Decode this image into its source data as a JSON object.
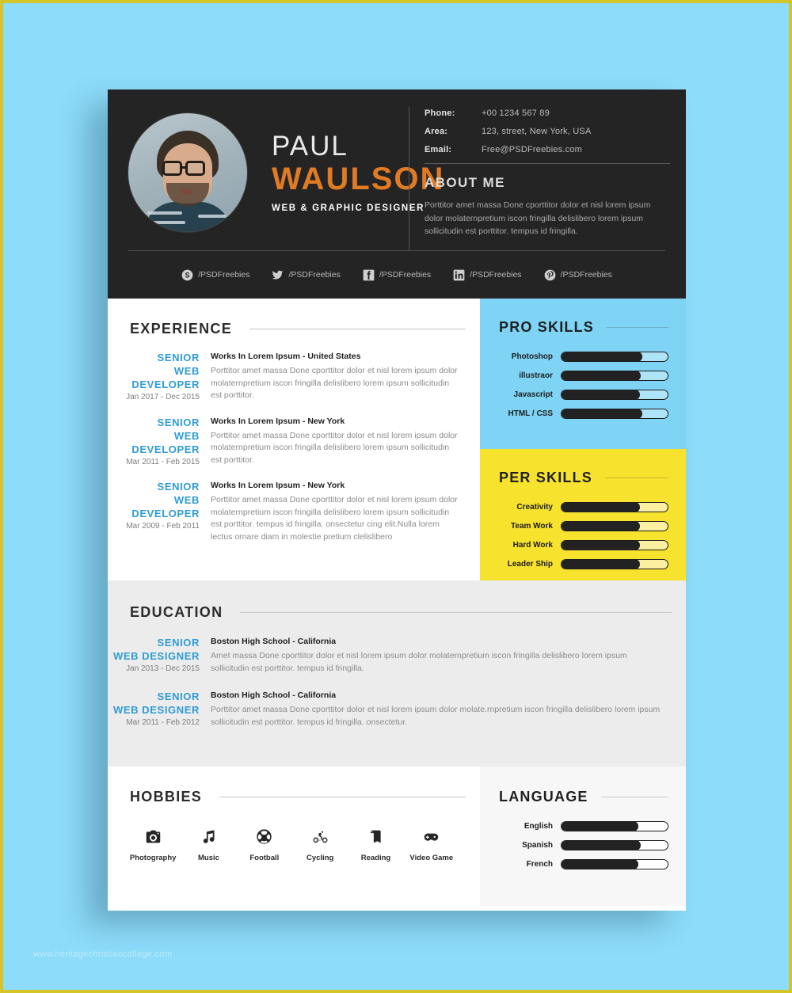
{
  "page": {
    "background_color": "#8ddcfa",
    "border_color": "#d4c629",
    "watermark": "www.heritagechristiancollege.com"
  },
  "colors": {
    "header_bg": "#242424",
    "accent_orange": "#e07b24",
    "accent_blue": "#2e9bd6",
    "panel_blue": "#7fd3f5",
    "panel_yellow": "#f7e22e",
    "education_bg": "#ececec",
    "bar_fill": "#222222"
  },
  "header": {
    "avatar_alt": "profile-photo",
    "name_first": "PAUL",
    "name_last": "WAULSON",
    "job_title": "WEB & GRAPHIC DESIGNER",
    "contacts": [
      {
        "label": "Phone:",
        "value": "+00 1234 567 89"
      },
      {
        "label": "Area:",
        "value": "123, street, New York, USA"
      },
      {
        "label": "Email:",
        "value": "Free@PSDFreebies.com"
      }
    ],
    "about_title": "ABOUT ME",
    "about_text": "Porttitor amet massa Done cporttitor dolor et nisl lorem ipsum dolor molaternpretium iscon fringilla delislibero lorem ipsum sollicitudin est porttitor. tempus id fringilla.",
    "socials": [
      {
        "icon": "skype-icon",
        "handle": "/PSDFreebies"
      },
      {
        "icon": "twitter-icon",
        "handle": "/PSDFreebies"
      },
      {
        "icon": "facebook-icon",
        "handle": "/PSDFreebies"
      },
      {
        "icon": "linkedin-icon",
        "handle": "/PSDFreebies"
      },
      {
        "icon": "pinterest-icon",
        "handle": "/PSDFreebies"
      }
    ]
  },
  "experience": {
    "title": "EXPERIENCE",
    "items": [
      {
        "role_line1": "SENIOR",
        "role_line2": "WEB DEVELOPER",
        "date": "Jan 2017 - Dec 2015",
        "company": "Works In Lorem Ipsum - United States",
        "description": "Porttitor amet massa Done cporttitor dolor et nisl lorem ipsum dolor molaternpretium iscon fringilla delislibero lorem ipsum sollicitudin est porttitor."
      },
      {
        "role_line1": "SENIOR",
        "role_line2": "WEB DEVELOPER",
        "date": "Mar 2011 - Feb 2015",
        "company": "Works In Lorem Ipsum - New York",
        "description": "Porttitor amet massa Done cporttitor dolor et nisl lorem ipsum dolor molaternpretium iscon fringilla delislibero lorem ipsum sollicitudin est porttitor."
      },
      {
        "role_line1": "SENIOR",
        "role_line2": "WEB DEVELOPER",
        "date": "Mar 2009 - Feb 2011",
        "company": "Works In Lorem Ipsum - New York",
        "description": "Porttitor amet massa Done cporttitor dolor et nisl lorem ipsum dolor molaternpretium iscon fringilla delislibero lorem ipsum sollicitudin est porttitor. tempus id fringilla. onsectetur cing elit.Nulla lorem lectus ornare diam in molestie pretium clelislibero"
      }
    ]
  },
  "pro_skills": {
    "title": "PRO SKILLS",
    "items": [
      {
        "name": "Photoshop",
        "value": 75
      },
      {
        "name": "illustraor",
        "value": 74
      },
      {
        "name": "Javascript",
        "value": 73
      },
      {
        "name": "HTML / CSS",
        "value": 75
      }
    ]
  },
  "per_skills": {
    "title": "PER SKILLS",
    "items": [
      {
        "name": "Creativity",
        "value": 73
      },
      {
        "name": "Team Work",
        "value": 73
      },
      {
        "name": "Hard Work",
        "value": 73
      },
      {
        "name": "Leader Ship",
        "value": 73
      }
    ]
  },
  "education": {
    "title": "EDUCATION",
    "items": [
      {
        "role_line1": "SENIOR",
        "role_line2": "WEB DESIGNER",
        "date": "Jan 2013 - Dec 2015",
        "school": "Boston High School - California",
        "description": "Amet massa Done cporttitor dolor et nisl lorem ipsum dolor molaternpretium iscon fringilla delislibero lorem ipsum sollicitudin est porttitor. tempus id fringilla."
      },
      {
        "role_line1": "SENIOR",
        "role_line2": "WEB DESIGNER",
        "date": "Mar 2011 - Feb 2012",
        "school": "Boston High School - California",
        "description": "Porttitor amet massa Done cporttitor dolor et nisl lorem ipsum dolor molate.rnpretium iscon fringilla delislibero lorem ipsum sollicitudin est porttitor. tempus id fringilla. onsectetur."
      }
    ]
  },
  "hobbies": {
    "title": "HOBBIES",
    "items": [
      {
        "icon": "camera-icon",
        "label": "Photography"
      },
      {
        "icon": "music-note-icon",
        "label": "Music"
      },
      {
        "icon": "soccer-ball-icon",
        "label": "Football"
      },
      {
        "icon": "bicycle-icon",
        "label": "Cycling"
      },
      {
        "icon": "book-icon",
        "label": "Reading"
      },
      {
        "icon": "gamepad-icon",
        "label": "Video Game"
      }
    ]
  },
  "language": {
    "title": "LANGUAGE",
    "items": [
      {
        "name": "English",
        "value": 72
      },
      {
        "name": "Spanish",
        "value": 74
      },
      {
        "name": "French",
        "value": 72
      }
    ]
  }
}
